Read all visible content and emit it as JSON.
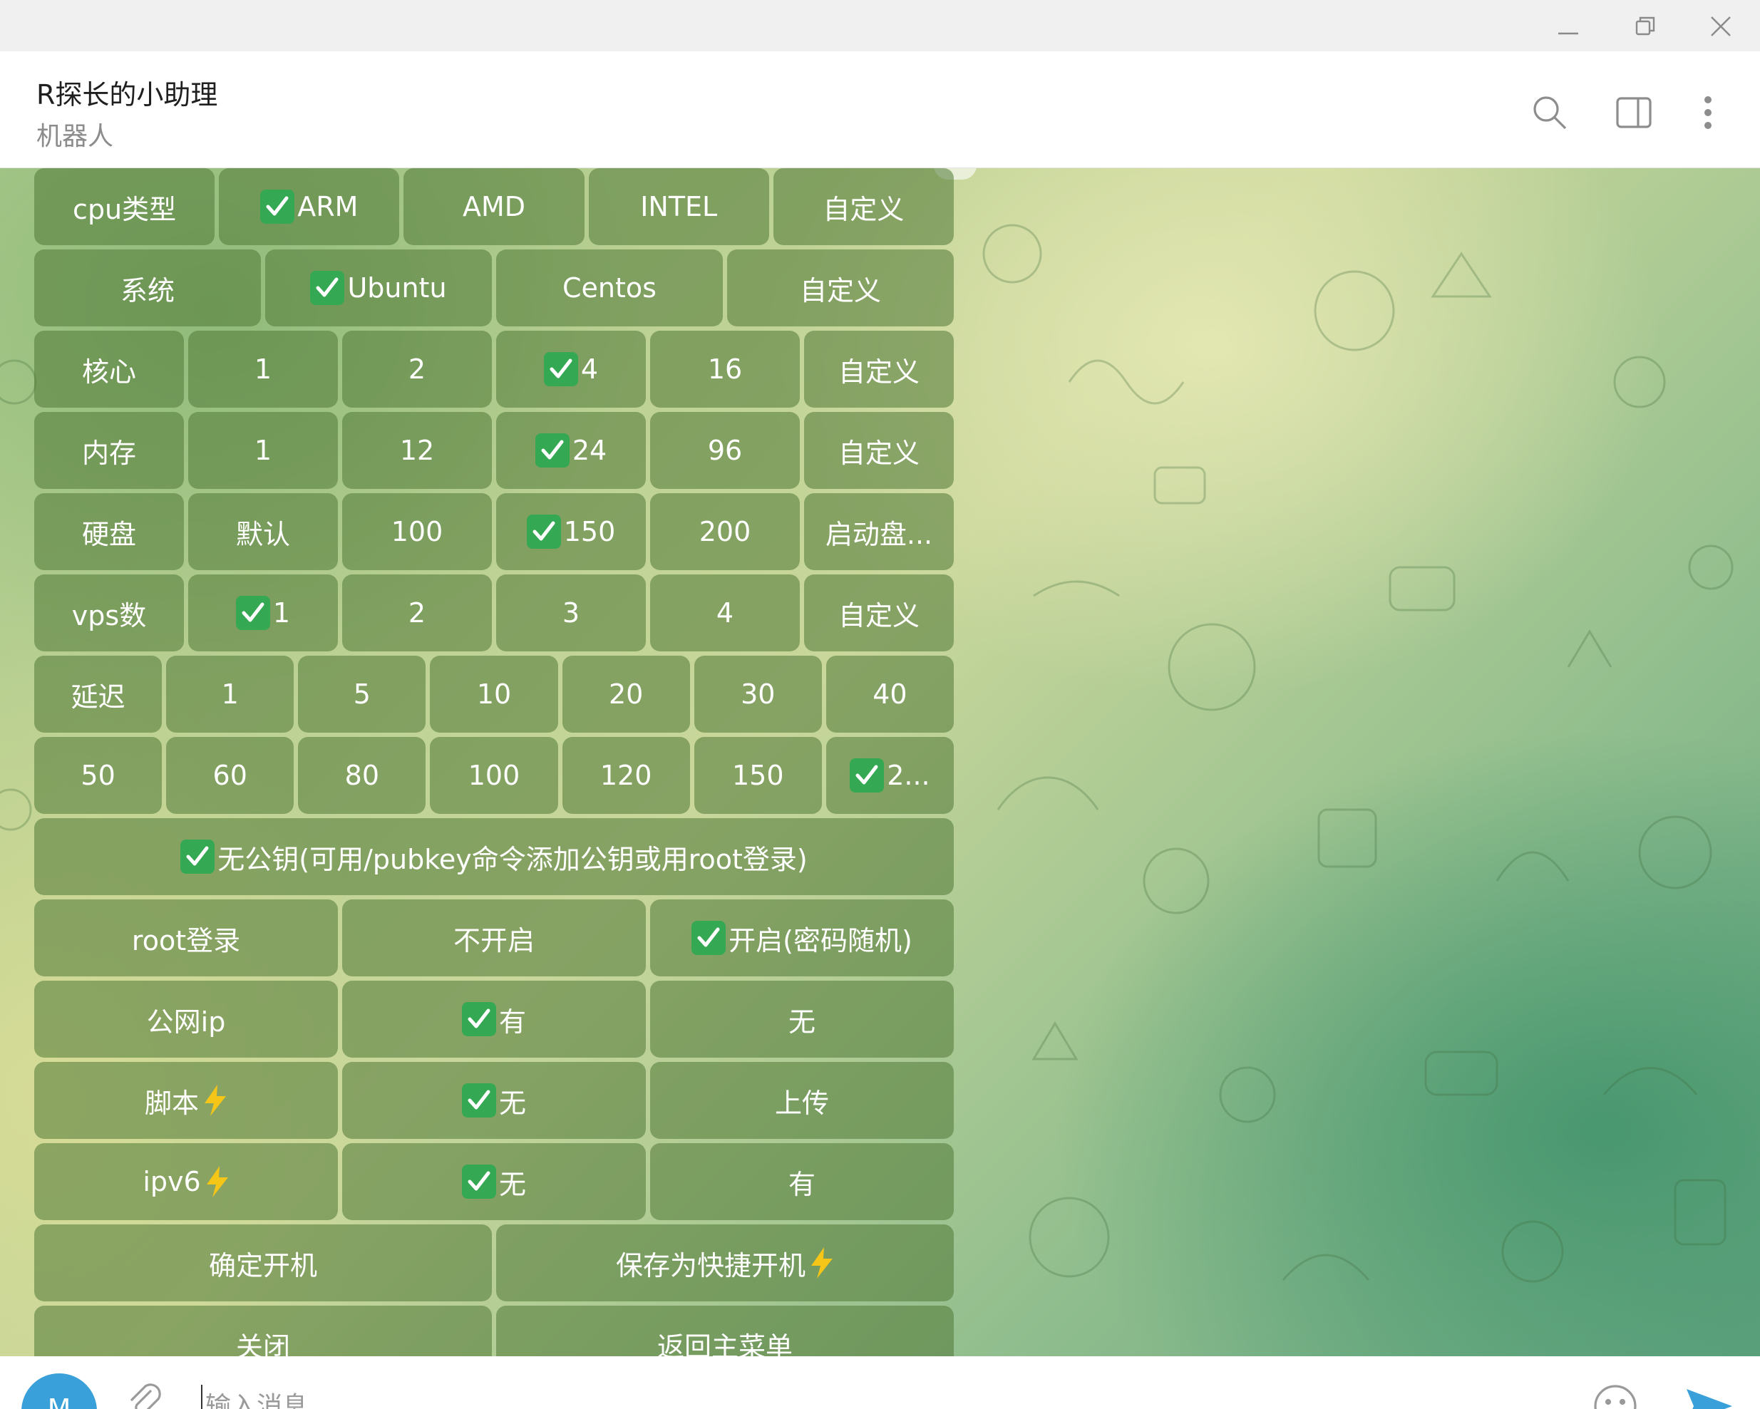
{
  "window": {
    "minimize_icon": "minimize-icon",
    "maximize_icon": "restore-icon",
    "close_icon": "close-icon"
  },
  "header": {
    "title": "R探长的小助理",
    "subtitle": "机器人",
    "icons": [
      "search-icon",
      "sidebar-panel-icon",
      "more-vertical-icon"
    ]
  },
  "keyboard": {
    "rows": [
      [
        {
          "label": "cpu类型",
          "checked": false
        },
        {
          "label": "ARM",
          "checked": true
        },
        {
          "label": "AMD",
          "checked": false
        },
        {
          "label": "INTEL",
          "checked": false
        },
        {
          "label": "自定义",
          "checked": false
        }
      ],
      [
        {
          "label": "系统",
          "checked": false
        },
        {
          "label": "Ubuntu",
          "checked": true
        },
        {
          "label": "Centos",
          "checked": false
        },
        {
          "label": "自定义",
          "checked": false
        }
      ],
      [
        {
          "label": "核心",
          "checked": false
        },
        {
          "label": "1",
          "checked": false
        },
        {
          "label": "2",
          "checked": false
        },
        {
          "label": "4",
          "checked": true
        },
        {
          "label": "16",
          "checked": false
        },
        {
          "label": "自定义",
          "checked": false
        }
      ],
      [
        {
          "label": "内存",
          "checked": false
        },
        {
          "label": "1",
          "checked": false
        },
        {
          "label": "12",
          "checked": false
        },
        {
          "label": "24",
          "checked": true
        },
        {
          "label": "96",
          "checked": false
        },
        {
          "label": "自定义",
          "checked": false
        }
      ],
      [
        {
          "label": "硬盘",
          "checked": false
        },
        {
          "label": "默认",
          "checked": false
        },
        {
          "label": "100",
          "checked": false
        },
        {
          "label": "150",
          "checked": true
        },
        {
          "label": "200",
          "checked": false
        },
        {
          "label": "启动盘...",
          "checked": false
        }
      ],
      [
        {
          "label": "vps数",
          "checked": false
        },
        {
          "label": "1",
          "checked": true
        },
        {
          "label": "2",
          "checked": false
        },
        {
          "label": "3",
          "checked": false
        },
        {
          "label": "4",
          "checked": false
        },
        {
          "label": "自定义",
          "checked": false
        }
      ],
      [
        {
          "label": "延迟",
          "checked": false
        },
        {
          "label": "1",
          "checked": false
        },
        {
          "label": "5",
          "checked": false
        },
        {
          "label": "10",
          "checked": false
        },
        {
          "label": "20",
          "checked": false
        },
        {
          "label": "30",
          "checked": false
        },
        {
          "label": "40",
          "checked": false
        }
      ],
      [
        {
          "label": "50",
          "checked": false
        },
        {
          "label": "60",
          "checked": false
        },
        {
          "label": "80",
          "checked": false
        },
        {
          "label": "100",
          "checked": false
        },
        {
          "label": "120",
          "checked": false
        },
        {
          "label": "150",
          "checked": false
        },
        {
          "label": "2...",
          "checked": true
        }
      ],
      [
        {
          "label": "无公钥(可用/pubkey命令添加公钥或用root登录)",
          "checked": true
        }
      ],
      [
        {
          "label": "root登录",
          "checked": false
        },
        {
          "label": "不开启",
          "checked": false
        },
        {
          "label": "开启(密码随机)",
          "checked": true
        }
      ],
      [
        {
          "label": "公网ip",
          "checked": false
        },
        {
          "label": "有",
          "checked": true
        },
        {
          "label": "无",
          "checked": false
        }
      ],
      [
        {
          "label": "脚本",
          "checked": false,
          "bolt": true
        },
        {
          "label": "无",
          "checked": true
        },
        {
          "label": "上传",
          "checked": false
        }
      ],
      [
        {
          "label": "ipv6",
          "checked": false,
          "bolt": true
        },
        {
          "label": "无",
          "checked": true
        },
        {
          "label": "有",
          "checked": false
        }
      ],
      [
        {
          "label": "确定开机",
          "checked": false
        },
        {
          "label": "保存为快捷开机",
          "checked": false,
          "bolt": true
        }
      ],
      [
        {
          "label": "关闭",
          "checked": false
        },
        {
          "label": "返回主菜单",
          "checked": false
        }
      ]
    ]
  },
  "composer": {
    "avatar_letter": "M",
    "placeholder": "输入消息",
    "icons": [
      "attach-icon",
      "emoji-icon",
      "send-icon"
    ]
  },
  "colors": {
    "accent": "#3aa0d9",
    "check_green": "#34a853",
    "bolt_yellow": "#f5c518",
    "send_blue": "#3aa0d9"
  }
}
